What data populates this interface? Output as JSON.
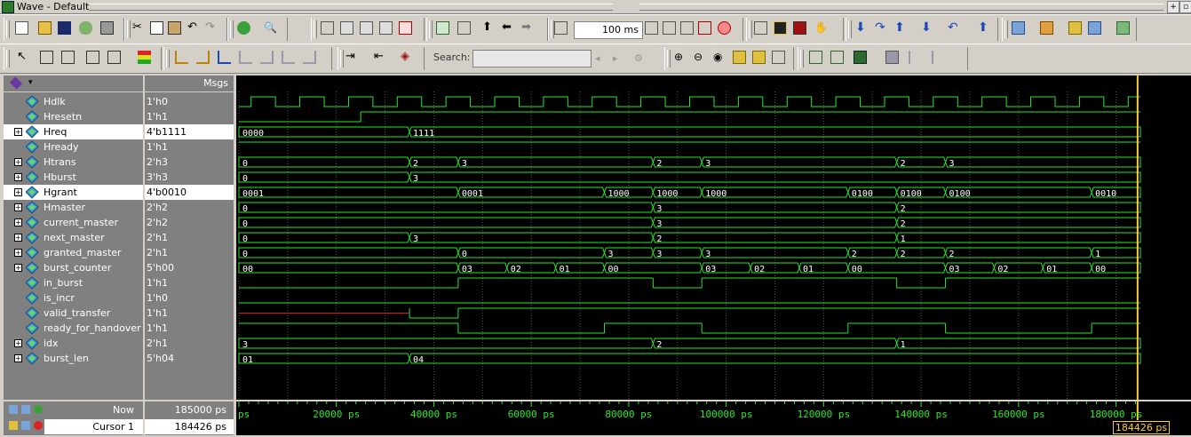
{
  "window": {
    "title": "Wave - Default"
  },
  "toolbar2": {
    "time_step": "100 ms",
    "search_label": "Search:",
    "search_value": ""
  },
  "columns": {
    "messages_header": "Msgs"
  },
  "colors": {
    "wave": "#29e829",
    "grid": "#555555",
    "cursor": "#ffcc33",
    "invalid": "#d92020"
  },
  "signals": [
    {
      "name": "Hdlk",
      "value": "1'h0",
      "expandable": false
    },
    {
      "name": "Hresetn",
      "value": "1'h1",
      "expandable": false
    },
    {
      "name": "Hreq",
      "value": "4'b1111",
      "expandable": true,
      "selected": true
    },
    {
      "name": "Hready",
      "value": "1'h1",
      "expandable": false
    },
    {
      "name": "Htrans",
      "value": "2'h3",
      "expandable": true
    },
    {
      "name": "Hburst",
      "value": "3'h3",
      "expandable": true
    },
    {
      "name": "Hgrant",
      "value": "4'b0010",
      "expandable": true,
      "selected": true
    },
    {
      "name": "Hmaster",
      "value": "2'h2",
      "expandable": true
    },
    {
      "name": "current_master",
      "value": "2'h2",
      "expandable": true
    },
    {
      "name": "next_master",
      "value": "2'h1",
      "expandable": true
    },
    {
      "name": "granted_master",
      "value": "2'h1",
      "expandable": true
    },
    {
      "name": "burst_counter",
      "value": "5'h00",
      "expandable": true
    },
    {
      "name": "in_burst",
      "value": "1'h1",
      "expandable": false
    },
    {
      "name": "is_incr",
      "value": "1'h0",
      "expandable": false
    },
    {
      "name": "valid_transfer",
      "value": "1'h1",
      "expandable": false
    },
    {
      "name": "ready_for_handover",
      "value": "1'h1",
      "expandable": false
    },
    {
      "name": "idx",
      "value": "2'h1",
      "expandable": true
    },
    {
      "name": "burst_len",
      "value": "5'h04",
      "expandable": true
    }
  ],
  "waves": {
    "Hdlk": {
      "kind": "clock",
      "first_edge_ps": 2500,
      "half_period_ps": 5000
    },
    "Hresetn": {
      "kind": "bit",
      "edges": [
        [
          0,
          0
        ],
        [
          25000,
          1
        ]
      ]
    },
    "Hreq": {
      "kind": "bus",
      "segments": [
        [
          0,
          "0000"
        ],
        [
          35000,
          "1111"
        ]
      ]
    },
    "Hready": {
      "kind": "bit",
      "edges": [
        [
          0,
          1
        ]
      ]
    },
    "Htrans": {
      "kind": "bus",
      "segments": [
        [
          0,
          "0"
        ],
        [
          35000,
          "2"
        ],
        [
          45000,
          "3"
        ],
        [
          85000,
          "2"
        ],
        [
          95000,
          "3"
        ],
        [
          135000,
          "2"
        ],
        [
          145000,
          "3"
        ]
      ]
    },
    "Hburst": {
      "kind": "bus",
      "segments": [
        [
          0,
          "0"
        ],
        [
          35000,
          "3"
        ]
      ]
    },
    "Hgrant": {
      "kind": "bus",
      "segments": [
        [
          0,
          "0001"
        ],
        [
          45000,
          "0001"
        ],
        [
          75000,
          "1000"
        ],
        [
          85000,
          "1000"
        ],
        [
          95000,
          "1000"
        ],
        [
          125000,
          "0100"
        ],
        [
          135000,
          "0100"
        ],
        [
          145000,
          "0100"
        ],
        [
          175000,
          "0010"
        ]
      ]
    },
    "Hmaster": {
      "kind": "bus",
      "segments": [
        [
          0,
          "0"
        ],
        [
          85000,
          "3"
        ],
        [
          135000,
          "2"
        ]
      ]
    },
    "current_master": {
      "kind": "bus",
      "segments": [
        [
          0,
          "0"
        ],
        [
          85000,
          "3"
        ],
        [
          135000,
          "2"
        ]
      ]
    },
    "next_master": {
      "kind": "bus",
      "segments": [
        [
          0,
          "0"
        ],
        [
          35000,
          "3"
        ],
        [
          85000,
          "2"
        ],
        [
          135000,
          "1"
        ]
      ]
    },
    "granted_master": {
      "kind": "bus",
      "segments": [
        [
          0,
          "0"
        ],
        [
          45000,
          "0"
        ],
        [
          75000,
          "3"
        ],
        [
          85000,
          "3"
        ],
        [
          95000,
          "3"
        ],
        [
          125000,
          "2"
        ],
        [
          135000,
          "2"
        ],
        [
          145000,
          "2"
        ],
        [
          175000,
          "1"
        ]
      ]
    },
    "burst_counter": {
      "kind": "bus",
      "segments": [
        [
          0,
          "00"
        ],
        [
          45000,
          "03"
        ],
        [
          55000,
          "02"
        ],
        [
          65000,
          "01"
        ],
        [
          75000,
          "00"
        ],
        [
          95000,
          "03"
        ],
        [
          105000,
          "02"
        ],
        [
          115000,
          "01"
        ],
        [
          125000,
          "00"
        ],
        [
          145000,
          "03"
        ],
        [
          155000,
          "02"
        ],
        [
          165000,
          "01"
        ],
        [
          175000,
          "00"
        ]
      ]
    },
    "in_burst": {
      "kind": "bit",
      "edges": [
        [
          0,
          0
        ],
        [
          45000,
          1
        ],
        [
          85000,
          0
        ],
        [
          95000,
          1
        ],
        [
          135000,
          0
        ],
        [
          145000,
          1
        ]
      ]
    },
    "is_incr": {
      "kind": "bit",
      "edges": [
        [
          0,
          0
        ]
      ]
    },
    "valid_transfer": {
      "kind": "bit",
      "edges": [
        [
          0,
          "x"
        ],
        [
          35000,
          0
        ],
        [
          45000,
          1
        ]
      ]
    },
    "ready_for_handover": {
      "kind": "bit",
      "edges": [
        [
          0,
          1
        ],
        [
          45000,
          0
        ],
        [
          75000,
          1
        ],
        [
          95000,
          0
        ],
        [
          125000,
          1
        ],
        [
          145000,
          0
        ],
        [
          175000,
          1
        ]
      ]
    },
    "idx": {
      "kind": "bus",
      "segments": [
        [
          0,
          "3"
        ],
        [
          85000,
          "2"
        ],
        [
          135000,
          "1"
        ]
      ]
    },
    "burst_len": {
      "kind": "bus",
      "segments": [
        [
          0,
          "01"
        ],
        [
          35000,
          "04"
        ]
      ]
    }
  },
  "timeline": {
    "labels": [
      "ps",
      "20000 ps",
      "40000 ps",
      "60000 ps",
      "80000 ps",
      "100000 ps",
      "120000 ps",
      "140000 ps",
      "160000 ps",
      "180000 ps"
    ],
    "range_ps": [
      0,
      185000
    ],
    "major_step_ps": 20000
  },
  "status": {
    "now_label": "Now",
    "now_value": "185000 ps",
    "cursor_label": "Cursor 1",
    "cursor_value": "184426 ps",
    "cursor_ps": 184426
  }
}
